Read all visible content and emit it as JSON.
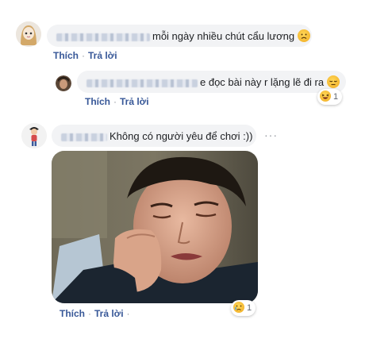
{
  "comments": [
    {
      "text": "mỗi ngày nhiều chút cẩu lương",
      "emoji": "frowning-face-emoji",
      "actions": {
        "like": "Thích",
        "reply": "Trả lời"
      }
    },
    {
      "text": "e đọc bài này r lặng lẽ đi ra",
      "emoji": "pensive-face-emoji",
      "actions": {
        "like": "Thích",
        "reply": "Trả lời"
      },
      "reaction": {
        "icon": "laughing-face-emoji",
        "count": "1"
      }
    },
    {
      "text": "Không có người yêu để chơi :))",
      "more_label": "···",
      "image": "crying-man-photo",
      "actions": {
        "like": "Thích",
        "reply": "Trả lời",
        "extra": "·"
      },
      "reaction": {
        "icon": "crying-face-emoji",
        "count": "1"
      }
    }
  ],
  "colors": {
    "bubble": "#f2f3f5",
    "link": "#385898",
    "emoji": "#f7b928"
  }
}
